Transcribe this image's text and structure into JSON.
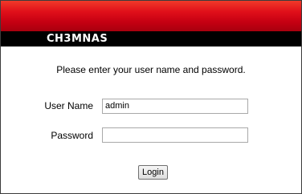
{
  "header": {
    "app_title": "CH3MNAS"
  },
  "login_form": {
    "prompt": "Please enter your user name and password.",
    "username_label": "User Name",
    "username_value": "admin",
    "password_label": "Password",
    "password_value": "",
    "submit_label": "Login"
  },
  "colors": {
    "banner_red": "#d8101a",
    "title_bar": "#000000",
    "title_text": "#ffffff"
  }
}
